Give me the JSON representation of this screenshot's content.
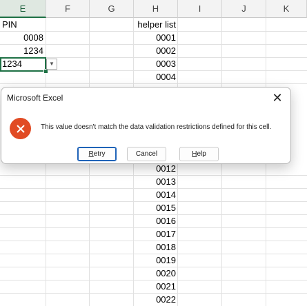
{
  "columns": [
    "E",
    "F",
    "G",
    "H",
    "I",
    "J",
    "K"
  ],
  "active_column": "E",
  "cells": {
    "pin_header": "PIN",
    "pin_values": [
      "0008",
      "1234"
    ],
    "active_cell_value": "1234",
    "helper_header": "helper list",
    "helper_top": [
      "0001",
      "0002",
      "0003",
      "0004"
    ],
    "helper_bottom": [
      "0012",
      "0013",
      "0014",
      "0015",
      "0016",
      "0017",
      "0018",
      "0019",
      "0020",
      "0021",
      "0022"
    ]
  },
  "dialog": {
    "title": "Microsoft Excel",
    "message": "This value doesn't match the data validation restrictions defined for this cell.",
    "buttons": [
      {
        "label": "Retry",
        "accel": "R"
      },
      {
        "label": "Cancel",
        "accel": ""
      },
      {
        "label": "Help",
        "accel": "H"
      }
    ],
    "error_color": "#e14b24"
  },
  "icons": {
    "close": "close-icon",
    "error": "error-icon",
    "dropdown": "chevron-down-icon"
  },
  "accent_color": "#1e7145"
}
